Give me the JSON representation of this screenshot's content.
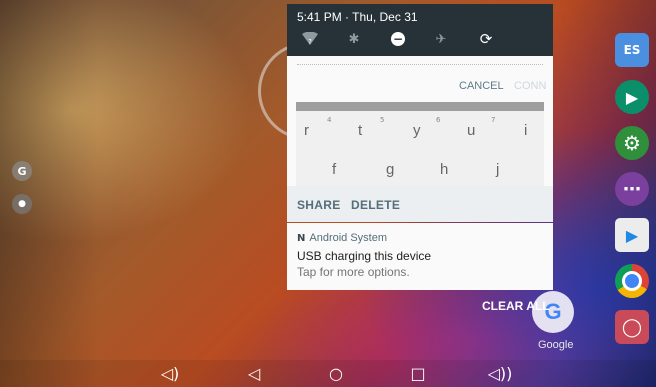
{
  "status": {
    "time": "5:41 PM",
    "separator": "·",
    "date": "Thu, Dec 31"
  },
  "quick_settings": [
    {
      "icon": "wifi-unknown-icon",
      "glyph": "▼"
    },
    {
      "icon": "bluetooth-off-icon",
      "glyph": "✱"
    },
    {
      "icon": "do-not-disturb-icon",
      "glyph": "−"
    },
    {
      "icon": "airplane-mode-icon",
      "glyph": "✈"
    },
    {
      "icon": "auto-rotate-icon",
      "glyph": "⟳"
    }
  ],
  "dialog_notification": {
    "cancel_label": "CANCEL",
    "connect_label": "CONN",
    "keyboard_row1": [
      {
        "key": "r",
        "hint": "4"
      },
      {
        "key": "t",
        "hint": "5"
      },
      {
        "key": "y",
        "hint": "6"
      },
      {
        "key": "u",
        "hint": "7"
      },
      {
        "key": "i",
        "hint": ""
      }
    ],
    "keyboard_row2": [
      "f",
      "g",
      "h",
      "j"
    ],
    "share_label": "SHARE",
    "delete_label": "DELETE"
  },
  "usb_notification": {
    "app_name": "Android System",
    "title": "USB charging this device",
    "body": "Tap for more options."
  },
  "clear_all_label": "CLEAR ALL",
  "google_label": "Google",
  "home_screen": {
    "left_dock": [
      "G",
      "●"
    ],
    "right_dock": [
      {
        "name": "es-file-explorer-icon",
        "text": "ES",
        "color": "#3a7bd5"
      },
      {
        "name": "play-store-icon",
        "text": "▶",
        "color": "#0b8f6a"
      },
      {
        "name": "settings-icon",
        "text": "⚙",
        "color": "#2e7d32"
      },
      {
        "name": "apps-drawer-icon",
        "text": "⋯",
        "color": "#7b3f9e"
      },
      {
        "name": "play-store-bag-icon",
        "text": "▶",
        "color": "#e8e8e8"
      },
      {
        "name": "chrome-icon",
        "text": "◉",
        "color": "#db4437"
      },
      {
        "name": "camera-icon",
        "text": "◯",
        "color": "#b03a48"
      }
    ]
  },
  "navigation": [
    {
      "name": "volume-down-button",
      "glyph": "◁)"
    },
    {
      "name": "back-button",
      "glyph": "◁"
    },
    {
      "name": "home-button",
      "glyph": "○"
    },
    {
      "name": "recents-button",
      "glyph": "□"
    },
    {
      "name": "volume-up-button",
      "glyph": "◁))"
    }
  ]
}
